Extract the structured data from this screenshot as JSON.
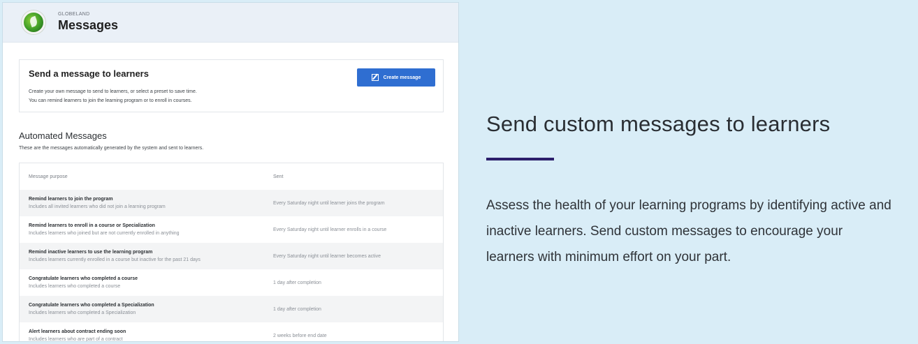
{
  "app": {
    "brand_name": "GLOBELAND",
    "page_title": "Messages"
  },
  "send_card": {
    "title": "Send a message to learners",
    "desc_line1": "Create your own message to send to learners, or select a preset to save time.",
    "desc_line2": "You can remind learners to join the learning program or to enroll in courses.",
    "create_button_label": "Create message"
  },
  "automated": {
    "title": "Automated Messages",
    "desc": "These are the messages automatically generated by the system and sent to learners.",
    "columns": [
      "Message purpose",
      "Sent"
    ],
    "rows": [
      {
        "title": "Remind learners to join the program",
        "sub": "Includes all invited learners who did not join a learning program",
        "sent": "Every Saturday night until learner joins the program"
      },
      {
        "title": "Remind learners to enroll in a course or Specialization",
        "sub": "Includes learners who joined but are not currently enrolled in anything",
        "sent": "Every Saturday night until learner enrolls in a course"
      },
      {
        "title": "Remind inactive learners to use the learning program",
        "sub": "Includes learners currently enrolled in a course but inactive for the past 21 days",
        "sent": "Every Saturday night until learner becomes active"
      },
      {
        "title": "Congratulate learners who completed a course",
        "sub": "Includes learners who completed a course",
        "sent": "1 day after completion"
      },
      {
        "title": "Congratulate learners who completed a Specialization",
        "sub": "Includes learners who completed a Specialization",
        "sent": "1 day after completion"
      },
      {
        "title": "Alert learners about contract ending soon",
        "sub": "Includes learners who are part of a contract",
        "sent": "2 weeks before end date"
      }
    ]
  },
  "marketing": {
    "headline": "Send custom messages to learners",
    "body": "Assess the health of your learning programs by identifying active and inactive learners. Send custom messages to encourage your learners with minimum effort on your part."
  },
  "colors": {
    "background": "#d9edf7",
    "primary_button": "#2f6ed1",
    "accent_rule": "#2c1f6b"
  },
  "icons": [
    "globe-logo-icon",
    "pen-edit-icon"
  ]
}
